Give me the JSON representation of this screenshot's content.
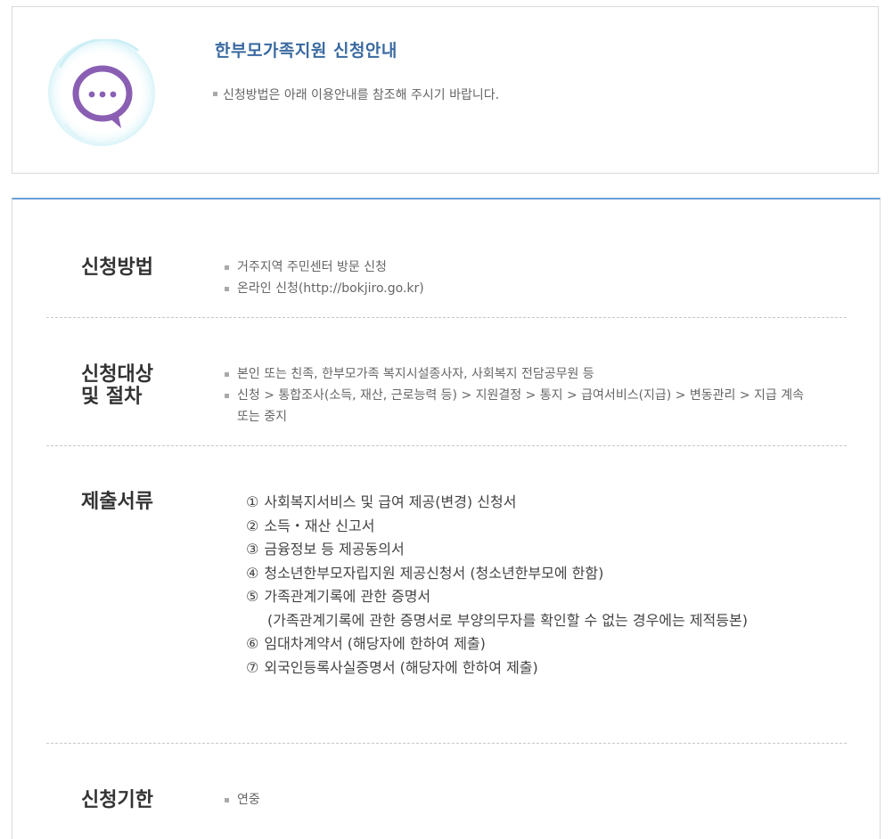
{
  "header": {
    "title": "한부모가족지원 신청안내",
    "description": "신청방법은 아래 이용안내를 참조해 주시기 바랍니다.",
    "icon": "chat-bubble-icon",
    "icon_color": "#8a5fb3"
  },
  "sections": {
    "method": {
      "title": "신청방법",
      "items": [
        "거주지역 주민센터 방문 신청",
        "온라인 신청(http://bokjiro.go.kr)"
      ]
    },
    "target": {
      "title_line1": "신청대상",
      "title_line2": "및 절차",
      "items": [
        "본인 또는 친족, 한부모가족 복지시설종사자, 사회복지 전담공무원 등",
        "신청 > 통합조사(소득, 재산, 근로능력 등) > 지원결정 > 통지 > 급여서비스(지급) > 변동관리 > 지급 계속 또는 중지"
      ]
    },
    "documents": {
      "title": "제출서류",
      "items": [
        {
          "num": "①",
          "text": "사회복지서비스 및 급여 제공(변경) 신청서"
        },
        {
          "num": "②",
          "text": "소득・재산 신고서"
        },
        {
          "num": "③",
          "text": "금융정보 등 제공동의서"
        },
        {
          "num": "④",
          "text": "청소년한부모자립지원 제공신청서 (청소년한부모에 한함)"
        },
        {
          "num": "⑤",
          "text": "가족관계기록에 관한 증명서"
        },
        {
          "num": "",
          "text": "(가족관계기록에 관한 증명서로 부양의무자를 확인할 수 없는 경우에는 제적등본)"
        },
        {
          "num": "⑥",
          "text": "임대차계약서 (해당자에 한하여 제출)"
        },
        {
          "num": "⑦",
          "text": "외국인등록사실증명서 (해당자에 한하여 제출)"
        }
      ]
    },
    "deadline": {
      "title": "신청기한",
      "items": [
        "연중"
      ]
    }
  },
  "colors": {
    "accent_blue": "#3a6aa0",
    "top_border": "#6a9fd6",
    "bubble_purple": "#8a5fb3"
  }
}
